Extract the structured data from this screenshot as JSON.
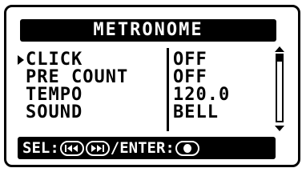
{
  "screen": {
    "title": "METRONOME"
  },
  "menu": {
    "items": [
      {
        "label": "CLICK",
        "value": "OFF",
        "selected": true
      },
      {
        "label": "PRE COUNT",
        "value": "OFF",
        "selected": false
      },
      {
        "label": "TEMPO",
        "value": "120.0",
        "selected": false
      },
      {
        "label": "SOUND",
        "value": "BELL",
        "selected": false
      }
    ]
  },
  "scrollbar": {
    "position_fraction": 0.0,
    "visible_fraction": 0.1
  },
  "footer": {
    "select_label": "SEL:",
    "separator": "/",
    "enter_label": "ENTER:",
    "prev_icon": "rewind-icon",
    "next_icon": "fast-forward-icon",
    "enter_icon": "record-button-icon"
  },
  "colors": {
    "foreground": "#000000",
    "background": "#ffffff"
  }
}
